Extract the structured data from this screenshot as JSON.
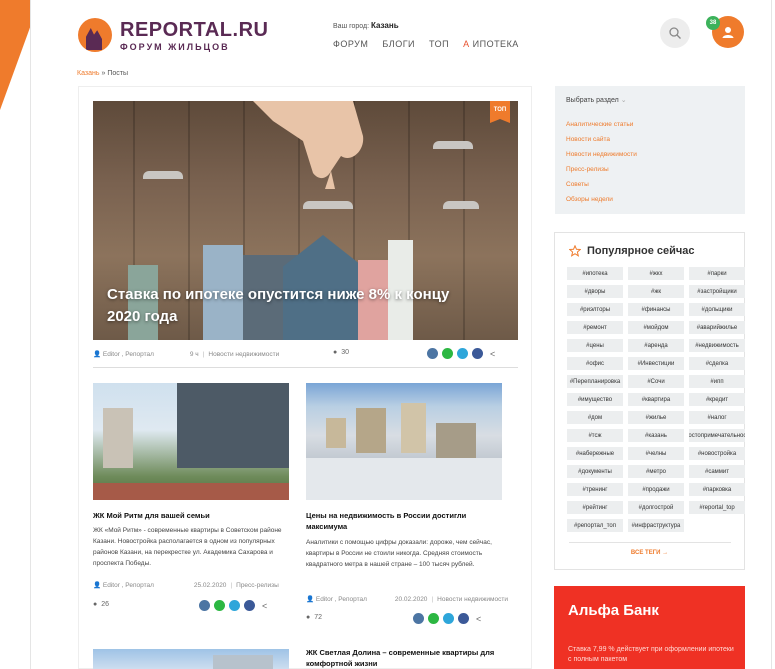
{
  "header": {
    "logo_title": "REPORTAL.RU",
    "logo_subtitle": "ФОРУМ ЖИЛЬЦОВ",
    "city_label": "Ваш город:",
    "city_value": "Казань",
    "nav": [
      "ФОРУМ",
      "БЛОГИ",
      "ТОП",
      "А",
      "ИПОТЕКА"
    ],
    "notification_count": "38"
  },
  "breadcrumb": {
    "home": "Казань",
    "sep": "»",
    "current": "Посты"
  },
  "featured": {
    "badge": "ТОП",
    "title": "Ставка по ипотеке опустится ниже 8% к концу 2020 года",
    "author": "Editor , Репортал",
    "date": "9 ч",
    "category": "Новости недвижимости",
    "views": "30"
  },
  "cards": [
    {
      "title": "ЖК Мой Ритм для вашей семьи",
      "text": "ЖК «Мой Ритм» - современные квартиры в Советском районе Казани. Новостройка располагается в одном из популярных районов Казани, на перекрестке ул. Академика Сахарова и проспекта Победы.",
      "author": "Editor , Репортал",
      "date": "25.02.2020",
      "category": "Пресс-релизы",
      "views": "26"
    },
    {
      "title": "Цены на недвижимость в России достигли максимума",
      "text": "Аналитики с помощью цифры доказали: дороже, чем сейчас, квартиры в России не стоили никогда. Средняя стоимость квадратного метра в нашей стране – 100 тысяч рублей.",
      "author": "Editor , Репортал",
      "date": "20.02.2020",
      "category": "Новости недвижимости",
      "views": "72"
    },
    {
      "title": "ЖК Светлая Долина – современные квартиры для комфортной жизни"
    }
  ],
  "sidebar": {
    "select_label": "Выбрать раздел",
    "categories": [
      "Аналитические статьи",
      "Новости сайта",
      "Новости недвижимости",
      "Пресс-релизы",
      "Советы",
      "Обзоры недели"
    ],
    "popular_title": "Популярное сейчас",
    "tags": [
      "#ипотека",
      "#жкх",
      "#парки",
      "#дворы",
      "#жк",
      "#застройщики",
      "#риэлторы",
      "#финансы",
      "#дольщики",
      "#ремонт",
      "#мойдом",
      "#аварийжилье",
      "#цены",
      "#аренда",
      "#недвижимость",
      "#офис",
      "#Инвестиции",
      "#сделка",
      "#Перепланировка",
      "#Сочи",
      "#ипп",
      "#имущество",
      "#квартира",
      "#кредит",
      "#дом",
      "#жилье",
      "#налог",
      "#тсж",
      "#казань",
      "#достопримечательности",
      "#набережные",
      "#челны",
      "#новостройка",
      "#документы",
      "#метро",
      "#саммит",
      "#тренинг",
      "#продажи",
      "#парковка",
      "#рейтинг",
      "#долгострой",
      "#reportal_top",
      "#репортал_топ",
      "#инфраструктура"
    ],
    "all_tags": "ВСЕ ТЕГИ →",
    "ad_brand": "Альфа Банк",
    "ad_text": "Ставка 7,99 % действует при оформлении ипотеки с полным пакетом"
  },
  "colors": {
    "accent": "#ef7b2c",
    "brand": "#5a2a54",
    "alfa": "#ef3124"
  }
}
